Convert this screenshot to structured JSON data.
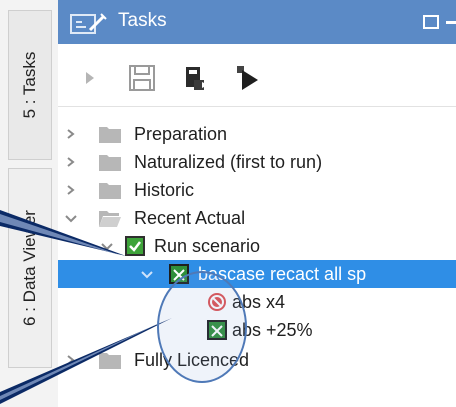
{
  "side_tabs": [
    {
      "label": "5 : Tasks"
    },
    {
      "label": "6 : Data Viewer"
    }
  ],
  "panel": {
    "title": "Tasks",
    "accent_color": "#5b8ac6",
    "selection_color": "#2f8ee6"
  },
  "toolbar": {
    "items": [
      "play-icon",
      "save-icon",
      "export-icon",
      "run-all-icon"
    ]
  },
  "tree": {
    "items": [
      {
        "label": "Preparation",
        "icon": "folder-icon",
        "expanded": false,
        "level": 0
      },
      {
        "label": "Naturalized (first to run)",
        "icon": "folder-icon",
        "expanded": false,
        "level": 0
      },
      {
        "label": "Historic",
        "icon": "folder-icon",
        "expanded": false,
        "level": 0
      },
      {
        "label": "Recent Actual",
        "icon": "folder-open-icon",
        "expanded": true,
        "level": 0
      },
      {
        "label": "Run scenario",
        "icon": "check-icon",
        "expanded": true,
        "level": 1
      },
      {
        "label": "bascase recact all sp",
        "icon": "tools-icon",
        "expanded": true,
        "level": 2,
        "selected": true
      },
      {
        "label": "abs x4",
        "icon": "error-icon",
        "level": 3
      },
      {
        "label": "abs +25%",
        "icon": "tools-icon",
        "level": 3
      },
      {
        "label": "Fully Licenced",
        "icon": "folder-icon",
        "expanded": false,
        "level": 0
      }
    ]
  }
}
